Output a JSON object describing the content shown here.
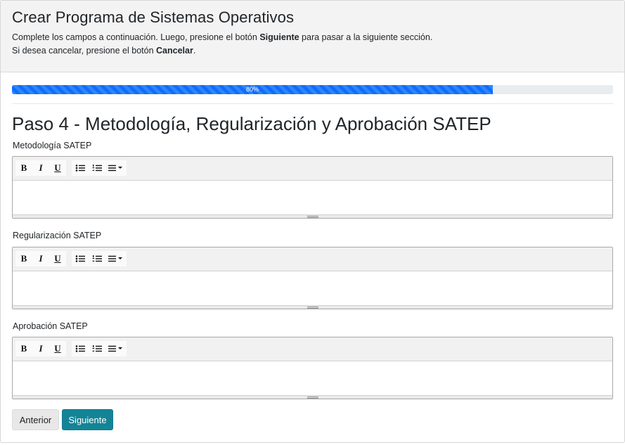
{
  "header": {
    "title": "Crear Programa de Sistemas Operativos",
    "line1_before": "Complete los campos a continuación. Luego, presione el botón ",
    "line1_bold": "Siguiente",
    "line1_after": " para pasar a la siguiente sección.",
    "line2_before": "Si desea cancelar, presione el botón ",
    "line2_bold": "Cancelar",
    "line2_after": "."
  },
  "progress": {
    "value": 80,
    "label": "80%",
    "color": "#0d6efd"
  },
  "step_title": "Paso 4 - Metodología, Regularización y Aprobación SATEP",
  "fields": [
    {
      "label": "Metodología SATEP",
      "value": ""
    },
    {
      "label": "Regularización SATEP",
      "value": ""
    },
    {
      "label": "Aprobación SATEP",
      "value": ""
    }
  ],
  "toolbar": {
    "bold": "B",
    "italic": "I",
    "underline": "U",
    "icons": [
      "bold-icon",
      "italic-icon",
      "underline-icon",
      "bulleted-list-icon",
      "numbered-list-icon",
      "align-dropdown-icon"
    ]
  },
  "buttons": {
    "previous": "Anterior",
    "next": "Siguiente",
    "next_color": "#138496"
  }
}
